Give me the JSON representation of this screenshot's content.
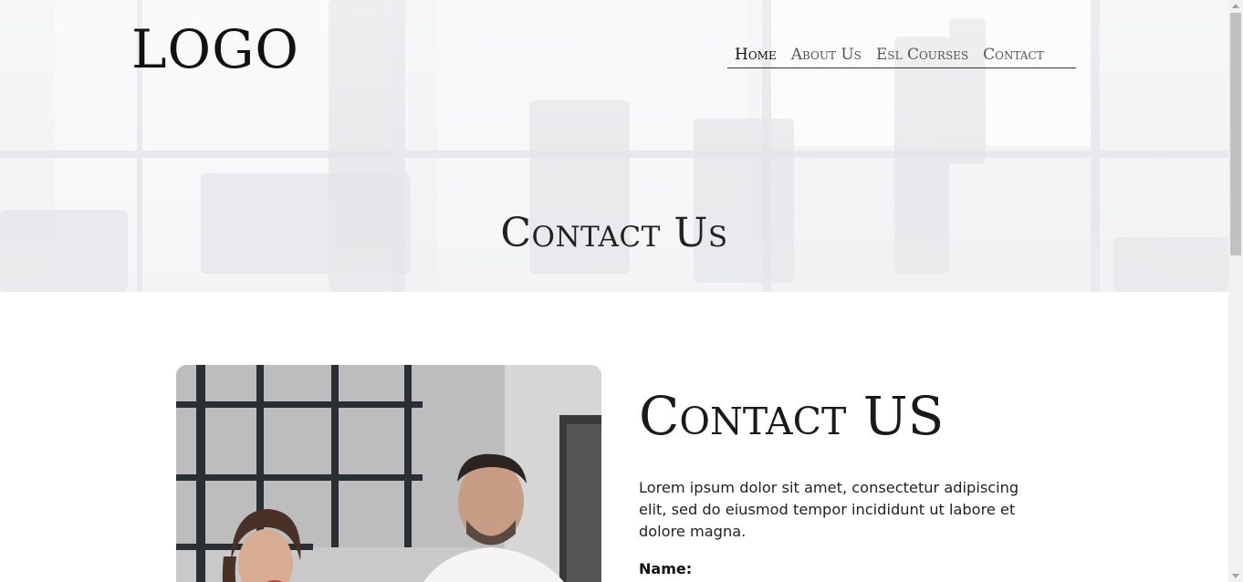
{
  "header": {
    "logo": "LOGO",
    "nav": [
      {
        "label": "Home",
        "active": true
      },
      {
        "label": "About Us",
        "active": false
      },
      {
        "label": "Esl Courses",
        "active": false
      },
      {
        "label": "Contact",
        "active": false
      }
    ]
  },
  "hero": {
    "title": "Contact Us"
  },
  "main": {
    "heading": "Contact US",
    "intro": "Lorem ipsum dolor sit amet, consectetur adipiscing elit, sed do eiusmod tempor incididunt ut labore et dolore magna.",
    "form": {
      "name_label": "Name:"
    }
  }
}
